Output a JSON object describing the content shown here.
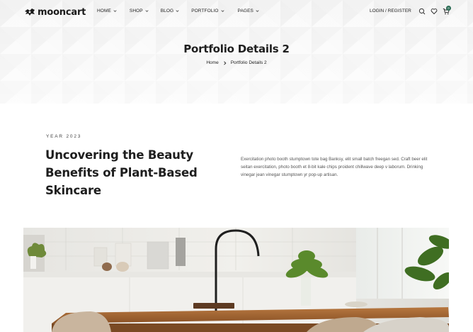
{
  "brand": {
    "name": "mooncart"
  },
  "nav": {
    "items": [
      {
        "label": "HOME"
      },
      {
        "label": "SHOP"
      },
      {
        "label": "BLOG"
      },
      {
        "label": "PORTFOLIO"
      },
      {
        "label": "PAGES"
      }
    ],
    "login_label": "LOGIN / REGISTER",
    "cart_count": "0"
  },
  "hero": {
    "title": "Portfolio Details 2",
    "breadcrumb": {
      "home": "Home",
      "current": "Portfolio Details 2"
    }
  },
  "project": {
    "year": "YEAR 2023",
    "title": "Uncovering the Beauty Benefits of Plant-Based Skincare",
    "description": "Exercitation photo booth stumptown tote bag Banksy, elit small batch freegan sed. Craft beer elit seitan exercitation, photo booth et 8-bit kale chips proident chillwave deep v laborum. Drinking vinegar jean vinegar stumptown yr pop-up artisan."
  },
  "colors": {
    "accent": "#2a6b54",
    "text": "#1e1e1e",
    "hero_bg": "#f4f4f4"
  },
  "icons": [
    "logo-icon",
    "chevron-down-icon",
    "search-icon",
    "heart-icon",
    "cart-icon",
    "chevron-right-icon"
  ]
}
